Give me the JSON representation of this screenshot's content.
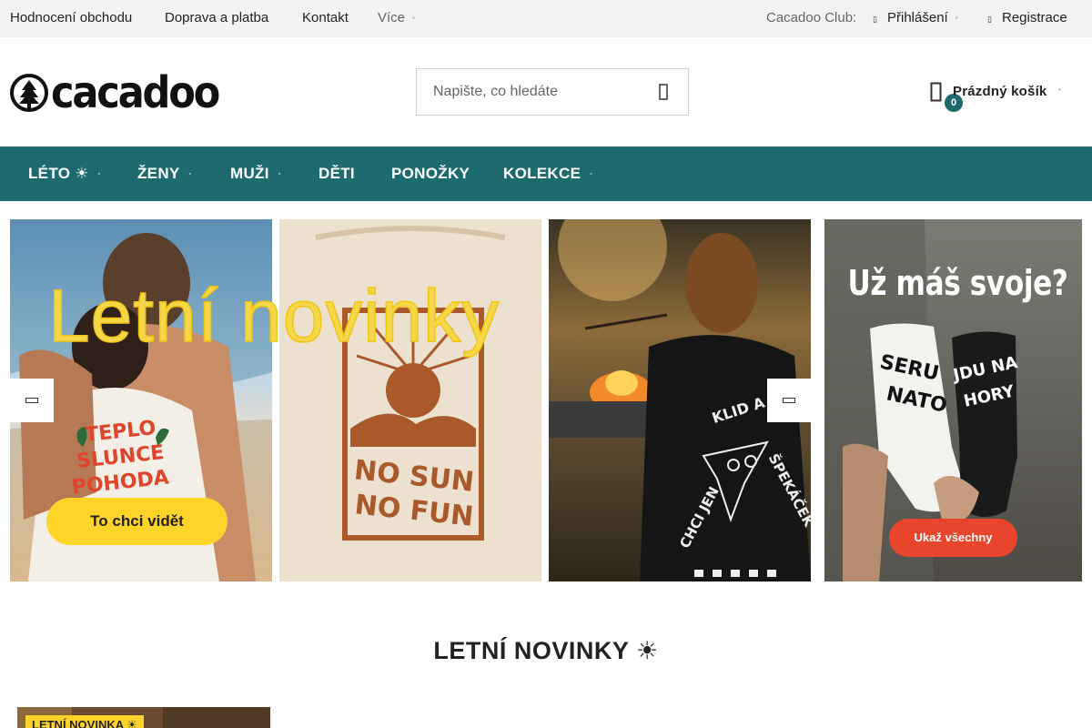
{
  "topbar": {
    "links": [
      "Hodnocení obchodu",
      "Doprava a platba",
      "Kontakt"
    ],
    "more_label": "Více",
    "club_label": "Cacadoo Club:",
    "login_label": "Přihlášení",
    "register_label": "Registrace"
  },
  "header": {
    "logo_text": "cacadoo",
    "search_placeholder": "Napište, co hledáte",
    "search_value": "",
    "cart_label": "Prázdný košík",
    "cart_count": "0"
  },
  "nav": {
    "items": [
      {
        "label": "LÉTO ☀",
        "has_dropdown": true
      },
      {
        "label": "ŽENY",
        "has_dropdown": true
      },
      {
        "label": "MUŽI",
        "has_dropdown": true
      },
      {
        "label": "DĚTI",
        "has_dropdown": false
      },
      {
        "label": "PONOŽKY",
        "has_dropdown": false
      },
      {
        "label": "KOLEKCE",
        "has_dropdown": true
      }
    ]
  },
  "banner": {
    "headline": "Letní novinky",
    "cta_label": "To chci vidět",
    "shirt_texts": [
      "TEPLO SLUNCE POHODA",
      "NO SUN NO FUN",
      "CHCI JEN KLID A ŠPEKÁČEK"
    ]
  },
  "promo": {
    "heading": "Už máš svoje?",
    "sock_texts": [
      "SERU NATO",
      "JDU NA HORY"
    ],
    "button_label": "Ukaž všechny"
  },
  "section": {
    "title": "LETNÍ NOVINKY ☀"
  },
  "product_card": {
    "tag": "LETNÍ NOVINKA ☀"
  },
  "colors": {
    "brand_teal": "#1d6b6e",
    "accent_yellow": "#ffd42a",
    "promo_red": "#e8452c"
  },
  "icons": {
    "logo": "tree-circle-icon",
    "search": "search-icon",
    "cart": "shopping-bag-icon",
    "login": "user-icon",
    "register": "user-add-icon",
    "slider_prev": "arrow-left-icon",
    "slider_next": "arrow-right-icon"
  }
}
